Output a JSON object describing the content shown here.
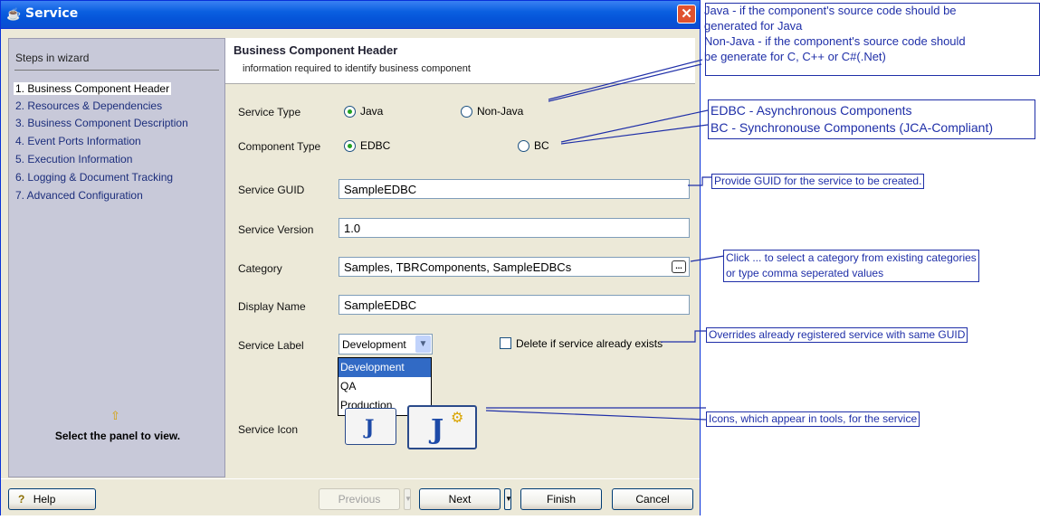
{
  "window": {
    "title": "Service",
    "close_label": "✕"
  },
  "sidebar": {
    "title": "Steps in wizard",
    "steps": [
      "1. Business Component Header",
      "2. Resources & Dependencies",
      "3. Business Component Description",
      "4. Event Ports Information",
      "5. Execution Information",
      "6. Logging & Document Tracking",
      "7. Advanced Configuration"
    ],
    "footer": "Select the panel to view."
  },
  "header": {
    "title": "Business Component Header",
    "subtitle": "information required to identify business component"
  },
  "form": {
    "service_type": {
      "label": "Service Type",
      "options": [
        "Java",
        "Non-Java"
      ],
      "selected": "Java"
    },
    "component_type": {
      "label": "Component Type",
      "options": [
        "EDBC",
        "BC"
      ],
      "selected": "EDBC"
    },
    "service_guid": {
      "label": "Service GUID",
      "value": "SampleEDBC"
    },
    "service_version": {
      "label": "Service Version",
      "value": "1.0"
    },
    "category": {
      "label": "Category",
      "value": "Samples, TBRComponents, SampleEDBCs",
      "browse": "..."
    },
    "display_name": {
      "label": "Display Name",
      "value": "SampleEDBC"
    },
    "service_label": {
      "label": "Service Label",
      "value": "Development",
      "options": [
        "Development",
        "QA",
        "Production"
      ]
    },
    "delete_checkbox": {
      "label": "Delete if service already exists",
      "checked": false
    },
    "service_icon": {
      "label": "Service Icon"
    }
  },
  "buttons": {
    "help": "Help",
    "previous": "Previous",
    "next": "Next",
    "finish": "Finish",
    "cancel": "Cancel"
  },
  "annotations": {
    "java": [
      "Java - if the component's source code should be",
      "generated for Java",
      "Non-Java - if the component's source code should",
      "be generate for C, C++ or C#(.Net)"
    ],
    "edbc": [
      "EDBC - Asynchronous Components",
      "BC - Synchronouse Components (JCA-Compliant)"
    ],
    "guid": "Provide GUID for the service to be created.",
    "category": [
      "Click ... to select a category from existing categories",
      "or type comma seperated values"
    ],
    "overrides": "Overrides already registered service with same GUID",
    "icons": "Icons, which appear in tools, for the service"
  },
  "colors": {
    "titlebar": "#0553d8",
    "annotation": "#1f2fa8",
    "sidebar": "#c8c9d9"
  }
}
